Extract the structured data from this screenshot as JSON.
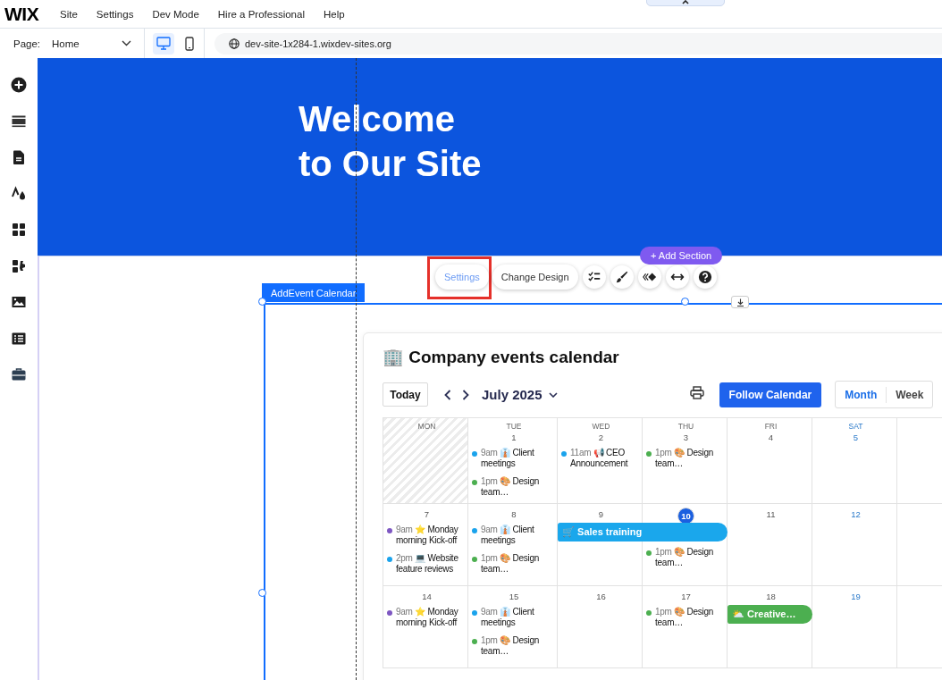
{
  "menu_bar": {
    "logo": "WIX",
    "items": [
      "Site",
      "Settings",
      "Dev Mode",
      "Hire a Professional",
      "Help"
    ]
  },
  "page_bar": {
    "page_label": "Page:",
    "page_value": "Home",
    "devices": [
      {
        "kind": "desktop",
        "selected": true
      },
      {
        "kind": "mobile",
        "selected": false
      }
    ],
    "url": "dev-site-1x284-1.wixdev-sites.org"
  },
  "hero": {
    "title_lines": [
      "Welcome",
      "to Our Site"
    ]
  },
  "editor": {
    "add_section": "+ Add Section",
    "toolbar": [
      {
        "label": "Settings",
        "highlighted": true
      },
      {
        "label": "Change Design",
        "highlighted": false
      }
    ],
    "widget_label": "AddEvent Calendar"
  },
  "calendar": {
    "title": "🏢 Company events calendar",
    "today_button": "Today",
    "month": "July 2025",
    "follow_button": "Follow Calendar",
    "views": [
      {
        "label": "Month",
        "selected": true
      },
      {
        "label": "Week",
        "selected": false
      }
    ],
    "weekdays": [
      {
        "label": "MON",
        "weekend": false
      },
      {
        "label": "TUE",
        "weekend": false
      },
      {
        "label": "WED",
        "weekend": false
      },
      {
        "label": "THU",
        "weekend": false
      },
      {
        "label": "FRI",
        "weekend": false
      },
      {
        "label": "SAT",
        "weekend": true
      }
    ],
    "weeks": [
      {
        "days": [
          {
            "outside": true
          },
          {
            "date": "1",
            "events": [
              {
                "time": "9am",
                "title": "👔 Client meetings",
                "color": "#1aa3ec"
              },
              {
                "time": "1pm",
                "title": "🎨 Design team…",
                "color": "#4caf50"
              }
            ]
          },
          {
            "date": "2",
            "events": [
              {
                "time": "11am",
                "title": "📢 CEO Announcement",
                "color": "#1aa3ec"
              }
            ]
          },
          {
            "date": "3",
            "events": [
              {
                "time": "1pm",
                "title": "🎨 Design team…",
                "color": "#4caf50"
              }
            ]
          },
          {
            "date": "4"
          },
          {
            "date": "5"
          }
        ]
      },
      {
        "days": [
          {
            "date": "7",
            "events": [
              {
                "time": "9am",
                "title": "⭐ Monday morning Kick-off",
                "color": "#7e57c2"
              },
              {
                "time": "2pm",
                "title": "💻 Website feature reviews",
                "color": "#1aa3ec"
              }
            ]
          },
          {
            "date": "8",
            "events": [
              {
                "time": "9am",
                "title": "👔 Client meetings",
                "color": "#1aa3ec"
              },
              {
                "time": "1pm",
                "title": "🎨 Design team…",
                "color": "#4caf50"
              }
            ]
          },
          {
            "date": "9",
            "bar": {
              "title": "🛒 Sales training",
              "color": "#1aa7ec"
            }
          },
          {
            "date": "10",
            "today": true,
            "continues_bar": true,
            "events": [
              {
                "time": "1pm",
                "title": "🎨 Design team…",
                "color": "#4caf50"
              }
            ]
          },
          {
            "date": "11"
          },
          {
            "date": "12"
          }
        ]
      },
      {
        "days": [
          {
            "date": "14",
            "events": [
              {
                "time": "9am",
                "title": "⭐ Monday morning Kick-off",
                "color": "#7e57c2"
              }
            ]
          },
          {
            "date": "15",
            "events": [
              {
                "time": "9am",
                "title": "👔 Client meetings",
                "color": "#1aa3ec"
              },
              {
                "time": "1pm",
                "title": "🎨 Design team…",
                "color": "#4caf50"
              }
            ]
          },
          {
            "date": "16"
          },
          {
            "date": "17",
            "events": [
              {
                "time": "1pm",
                "title": "🎨 Design team…",
                "color": "#4caf50"
              }
            ]
          },
          {
            "date": "18",
            "bar": {
              "title": "⛅ Creative…",
              "color": "#4caf50"
            }
          },
          {
            "date": "19"
          }
        ]
      }
    ]
  }
}
